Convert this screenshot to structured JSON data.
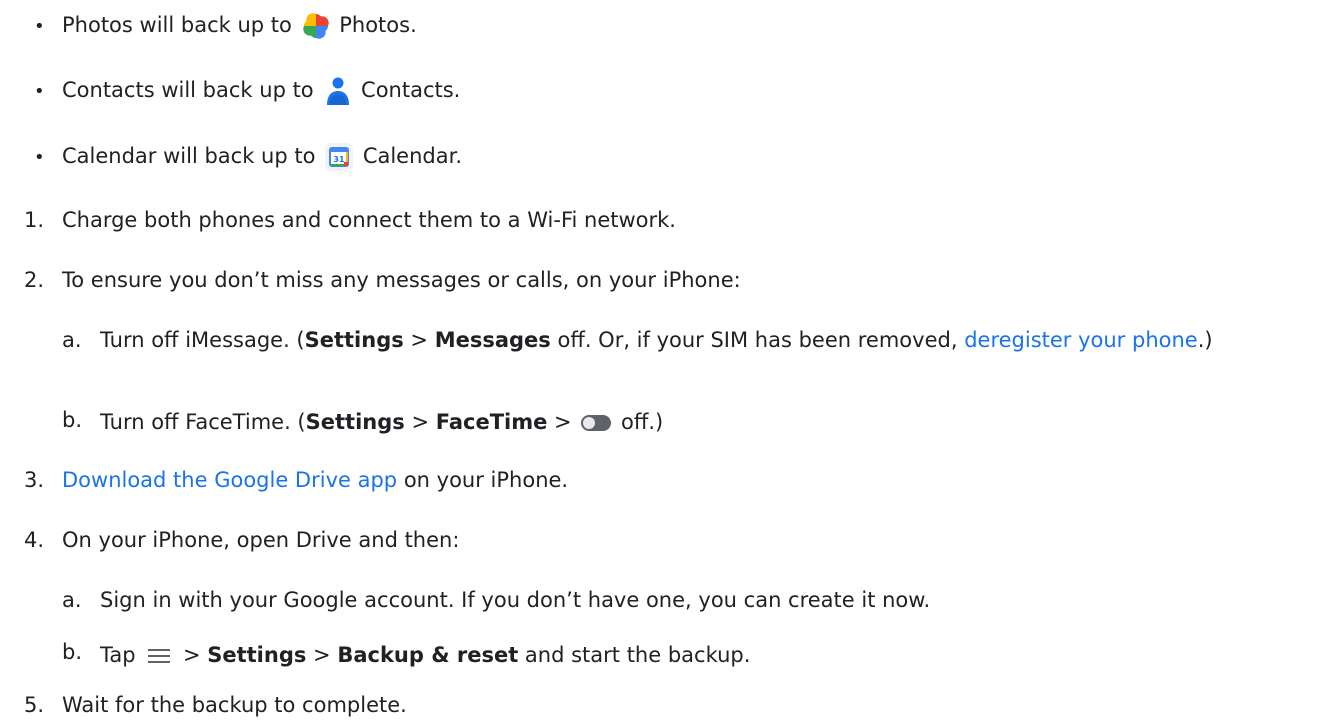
{
  "bullets": [
    {
      "before": "Photos will back up to",
      "icon": "google-photos-icon",
      "after": "Photos."
    },
    {
      "before": "Contacts will back up to",
      "icon": "google-contacts-icon",
      "after": "Contacts."
    },
    {
      "before": "Calendar will back up to",
      "icon": "google-calendar-icon",
      "icon_text": "31",
      "after": "Calendar."
    }
  ],
  "steps": {
    "s1": {
      "num": "1.",
      "text": "Charge both phones and connect them to a Wi-Fi network."
    },
    "s2": {
      "num": "2.",
      "text": "To ensure you don’t miss any messages or calls, on your iPhone:",
      "a": {
        "letter": "a.",
        "t1": "Turn off iMessage. (",
        "settings": "Settings",
        "sep": ">",
        "messages": "Messages",
        "t2": "off. Or, if your SIM has been removed,",
        "link": "deregister your phone",
        "t3": ".)"
      },
      "b": {
        "letter": "b.",
        "t1": "Turn off FaceTime. (",
        "settings": "Settings",
        "sep1": ">",
        "facetime": "FaceTime",
        "sep2": ">",
        "toggle_icon": "toggle-switch-icon",
        "t2": "off.)"
      }
    },
    "s3": {
      "num": "3.",
      "link": "Download the Google Drive app",
      "text": "on your iPhone."
    },
    "s4": {
      "num": "4.",
      "text": "On your iPhone, open Drive and then:",
      "a": {
        "letter": "a.",
        "text": "Sign in with your Google account. If you don’t have one, you can create it now."
      },
      "b": {
        "letter": "b.",
        "t1": "Tap",
        "menu_icon": "menu-icon",
        "sep1": ">",
        "settings": "Settings",
        "sep2": ">",
        "backup": "Backup & reset",
        "t2": "and start the backup."
      }
    },
    "s5": {
      "num": "5.",
      "text": "Wait for the backup to complete."
    }
  },
  "colors": {
    "text": "#202124",
    "link": "#1a73e8"
  }
}
